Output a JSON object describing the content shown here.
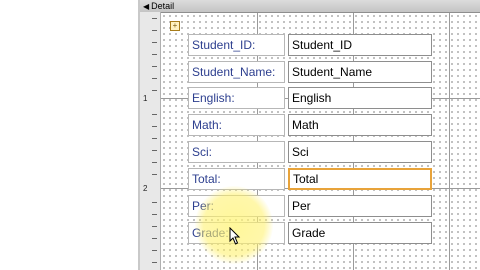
{
  "section": {
    "title": "Detail"
  },
  "ruler": {
    "marks": [
      "1",
      "2"
    ]
  },
  "fields": [
    {
      "label": "Student_ID:",
      "control": "Student_ID",
      "selected": false
    },
    {
      "label": "Student_Name:",
      "control": "Student_Name",
      "selected": false
    },
    {
      "label": "English:",
      "control": "English",
      "selected": false
    },
    {
      "label": "Math:",
      "control": "Math",
      "selected": false
    },
    {
      "label": "Sci:",
      "control": "Sci",
      "selected": false
    },
    {
      "label": "Total:",
      "control": "Total",
      "selected": true
    },
    {
      "label": "Per:",
      "control": "Per",
      "selected": false
    },
    {
      "label": "Grade:",
      "control": "Grade",
      "selected": false
    }
  ],
  "colors": {
    "selection": "#e8a33a",
    "label_text": "#2d3f8f",
    "highlight": "#fff27a"
  }
}
